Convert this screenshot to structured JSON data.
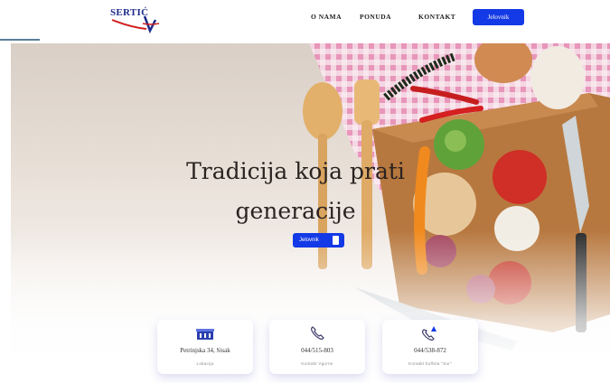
{
  "brand": {
    "logo_text": "SERTIĆ"
  },
  "nav": {
    "items": [
      {
        "label": "O NAMA"
      },
      {
        "label": "PONUDA"
      },
      {
        "label": "KONTAKT"
      }
    ],
    "button_label": "Jelovnik"
  },
  "hero": {
    "title_line1": "Tradicija koja prati",
    "title_line2": "generacije",
    "button_label": "Jelovnik"
  },
  "cards": [
    {
      "icon": "building-icon",
      "main": "Petrinjska 34, Sisak",
      "sub": "Lokacija"
    },
    {
      "icon": "phone-icon",
      "main": "044/515-803",
      "sub": "Kontakt Vgorne"
    },
    {
      "icon": "phone-bell-icon",
      "main": "044/538-872",
      "sub": "Kontakt buffeta \"Sur\""
    }
  ],
  "colors": {
    "accent": "#1439e6",
    "nav_text": "#222222",
    "title_text": "#2a2320"
  }
}
